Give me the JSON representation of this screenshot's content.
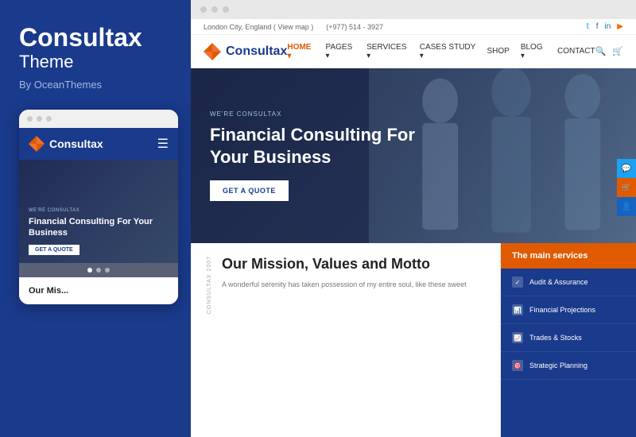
{
  "leftPanel": {
    "brandTitle": "Consultax",
    "brandSubtitle": "Theme",
    "brandBy": "By OceanThemes",
    "mobileMockup": {
      "dots": [
        "dot1",
        "dot2",
        "dot3"
      ],
      "navLogo": "Consultax",
      "heroTag": "WE'RE CONSULTAX",
      "heroTitle": "Financial Consulting For Your Business",
      "heroBtnLabel": "GET A QUOTE",
      "sectionTitle": "Our Mis..."
    }
  },
  "rightPanel": {
    "browserDots": [
      "d1",
      "d2",
      "d3"
    ],
    "infoBar": {
      "location": "London City, England ( View map )",
      "phone": "(+977) 514 - 3927",
      "socialIcons": [
        "twitter",
        "facebook",
        "linkedin",
        "rss"
      ]
    },
    "nav": {
      "logo": "Consultax",
      "links": [
        {
          "label": "HOME",
          "active": true
        },
        {
          "label": "PAGES",
          "active": false
        },
        {
          "label": "SERVICES",
          "active": false
        },
        {
          "label": "CASES STUDY",
          "active": false
        },
        {
          "label": "SHOP",
          "active": false
        },
        {
          "label": "BLOG",
          "active": false
        },
        {
          "label": "CONTACT",
          "active": false
        }
      ]
    },
    "hero": {
      "tag": "WE'RE CONSULTAX",
      "title": "Financial Consulting For Your Business",
      "btnLabel": "GET A QUOTE"
    },
    "missionSection": {
      "sideLabel": "CONSULTAX 2007",
      "title": "Our Mission, Values and Motto",
      "text": "A wonderful serenity has taken possession of my entire soul, like these sweet"
    },
    "servicesPanel": {
      "header": "The main services",
      "items": [
        {
          "icon": "audit",
          "label": "Audit & Assurance"
        },
        {
          "icon": "financial",
          "label": "Financial Projections"
        },
        {
          "icon": "trades",
          "label": "Trades & Stocks"
        },
        {
          "icon": "strategic",
          "label": "Strategic Planning"
        }
      ]
    },
    "floatingIcons": [
      {
        "type": "chat",
        "color": "blue"
      },
      {
        "type": "cart",
        "color": "orange"
      },
      {
        "type": "user",
        "color": "blue2"
      }
    ]
  }
}
